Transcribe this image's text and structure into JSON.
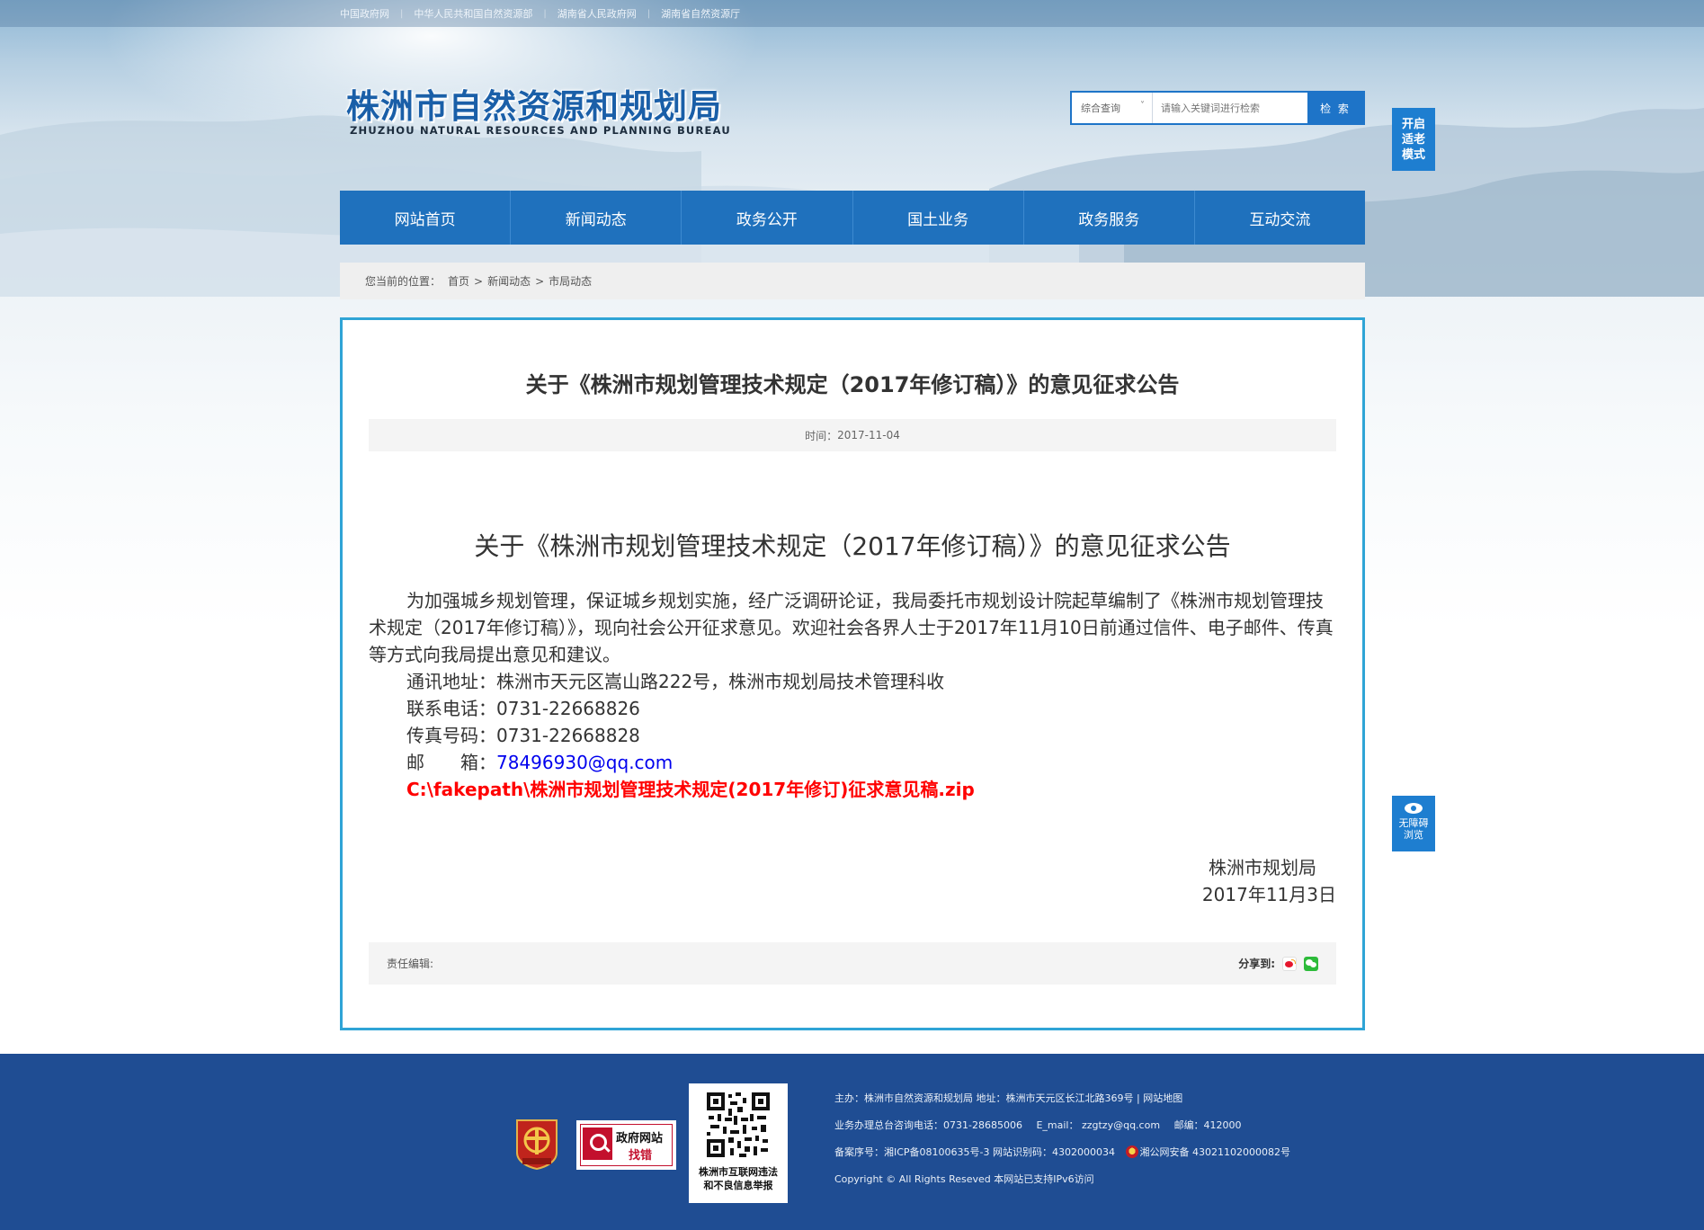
{
  "top_links": [
    "中国政府网",
    "中华人民共和国自然资源部",
    "湖南省人民政府网",
    "湖南省自然资源厅"
  ],
  "logo": {
    "cn": "株洲市自然资源和规划局",
    "en": "ZHUZHOU NATURAL RESOURCES AND PLANNING BUREAU"
  },
  "search": {
    "scope": "综合查询",
    "placeholder": "请输入关键词进行检索",
    "button": "检 索"
  },
  "elder_mode": [
    "开启",
    "适老",
    "模式"
  ],
  "nav": [
    "网站首页",
    "新闻动态",
    "政务公开",
    "国土业务",
    "政务服务",
    "互动交流"
  ],
  "breadcrumb": {
    "prefix": "您当前的位置：",
    "items": [
      "首页",
      "新闻动态",
      "市局动态"
    ],
    "sep": ">"
  },
  "article": {
    "title": "关于《株洲市规划管理技术规定（2017年修订稿）》的意见征求公告",
    "time_label": "时间：",
    "time": "2017-11-04",
    "body_title": "关于《株洲市规划管理技术规定（2017年修订稿）》的意见征求公告",
    "paragraph": "为加强城乡规划管理，保证城乡规划实施，经广泛调研论证，我局委托市规划设计院起草编制了《株洲市规划管理技术规定（2017年修订稿）》，现向社会公开征求意见。欢迎社会各界人士于2017年11月10日前通过信件、电子邮件、传真等方式向我局提出意见和建议。",
    "address_line": "通讯地址：株洲市天元区嵩山路222号，株洲市规划局技术管理科收",
    "phone_line": "联系电话：0731-22668826",
    "fax_line": "传真号码：0731-22668828",
    "email_label": "邮　　箱：",
    "email": "78496930@qq.com",
    "attachment": "C:\\fakepath\\株洲市规划管理技术规定(2017年修订)征求意见稿.zip",
    "sign_org": "株洲市规划局",
    "sign_date": "2017年11月3日",
    "editor_label": "责任编辑:",
    "share_label": "分享到:"
  },
  "accessibility": [
    "无障碍",
    "浏览"
  ],
  "footer": {
    "err_t1": "政府网站",
    "err_t2": "找错",
    "qr_caption_1": "株洲市互联网违法",
    "qr_caption_2": "和不良信息举报",
    "row1": "主办：株洲市自然资源和规划局   地址：株洲市天元区长江北路369号  |  网站地图",
    "row2_a": "业务办理总台咨询电话：0731-28685006",
    "row2_b": "E_mail：  zzgtzy@qq.com",
    "row2_c": "邮编：412000",
    "row3_a": "备案序号：湘ICP备08100635号-3  网站识别码：4302000034",
    "row3_b": "湘公网安备 43021102000082号",
    "row4": "Copyright © All Rights Reseved 本网站已支持IPv6访问"
  },
  "colors": {
    "nav_blue": "#1f71bd",
    "content_border": "#2fa4d6",
    "footer_bg": "#1f4d93",
    "attachment_red": "#ff0000",
    "link_blue": "#0000ee"
  }
}
